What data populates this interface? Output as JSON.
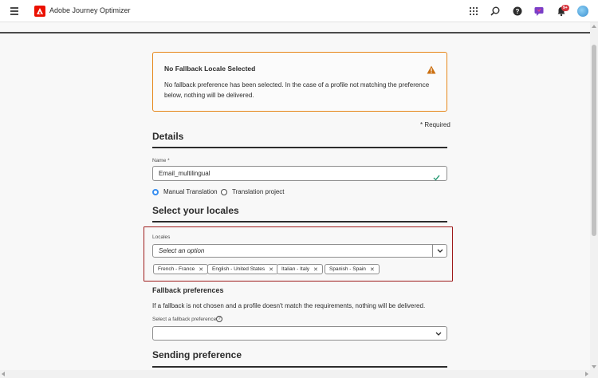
{
  "header": {
    "app_title": "Adobe Journey Optimizer",
    "notification_badge": "9+",
    "icons": [
      "menu-icon",
      "adobe-logo-icon",
      "apps-grid-icon",
      "search-icon",
      "help-icon",
      "feedback-icon",
      "bell-icon",
      "avatar"
    ]
  },
  "alert": {
    "title": "No Fallback Locale Selected",
    "text": "No fallback preference has been selected. In the case of a profile not matching the preference below, nothing will be delivered.",
    "accent_color": "#e68619"
  },
  "form": {
    "required_note": "* Required",
    "details_heading": "Details",
    "name_label": "Name",
    "name_required_marker": "*",
    "name_value": "Email_multilingual",
    "radio_manual": "Manual Translation",
    "radio_project": "Translation project",
    "selected_radio": "Manual Translation",
    "locales_heading": "Select your locales",
    "locales_label": "Locales",
    "locales_placeholder": "Select an option",
    "locale_tags": [
      "French - France",
      "English - United States",
      "Italian - Italy",
      "Spanish - Spain"
    ],
    "fallback_heading": "Fallback preferences",
    "fallback_text": "If a fallback is not chosen and a profile doesn't match the requirements, nothing will be delivered.",
    "fallback_label": "Select a fallback preference",
    "fallback_value": "",
    "sending_heading": "Sending preference"
  },
  "colors": {
    "highlight_border": "#9e1b1b",
    "radio_selected": "#378ef0",
    "brand": "#eb1000"
  }
}
